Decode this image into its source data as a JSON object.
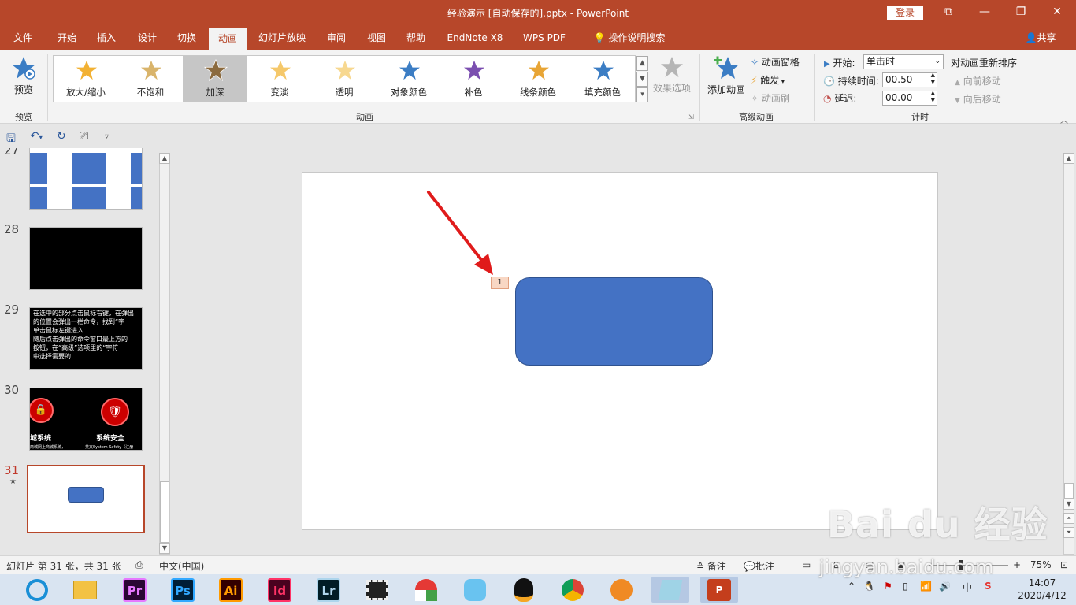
{
  "titlebar": {
    "title": "经验演示 [自动保存的].pptx  -  PowerPoint",
    "login": "登录",
    "restore_symbol": "⧉",
    "minimize_symbol": "—",
    "maximize_symbol": "❐",
    "close_symbol": "✕"
  },
  "tabs": [
    "文件",
    "开始",
    "插入",
    "设计",
    "切换",
    "动画",
    "幻灯片放映",
    "审阅",
    "视图",
    "帮助",
    "EndNote X8",
    "WPS PDF",
    "操作说明搜索"
  ],
  "active_tab": "动画",
  "share": "共享",
  "ribbon": {
    "preview": {
      "label": "预览",
      "group": "预览"
    },
    "animations": {
      "group": "动画",
      "items": [
        {
          "label": "放大/缩小",
          "color": "#f2b133"
        },
        {
          "label": "不饱和",
          "color": "#d9b46b"
        },
        {
          "label": "加深",
          "color": "#8b6a3e"
        },
        {
          "label": "变淡",
          "color": "#f5c86a"
        },
        {
          "label": "透明",
          "color": "#f7d890"
        },
        {
          "label": "对象颜色",
          "color": "#3b7dc4"
        },
        {
          "label": "补色",
          "color": "#7b4fb0"
        },
        {
          "label": "线条颜色",
          "color": "#e8a535"
        },
        {
          "label": "填充颜色",
          "color": "#3b7dc4"
        }
      ],
      "selected": "加深",
      "effect_options": "效果选项"
    },
    "advanced": {
      "group": "高级动画",
      "add_animation": "添加动画",
      "animation_pane": "动画窗格",
      "trigger": "触发",
      "painter": "动画刷"
    },
    "timing": {
      "group": "计时",
      "start_label": "开始:",
      "start_value": "单击时",
      "duration_label": "持续时间:",
      "duration_value": "00.50",
      "delay_label": "延迟:",
      "delay_value": "00.00",
      "reorder": "对动画重新排序",
      "move_earlier": "向前移动",
      "move_later": "向后移动"
    }
  },
  "thumbnails": [
    {
      "num": "27",
      "type": "blocks"
    },
    {
      "num": "28",
      "type": "black"
    },
    {
      "num": "29",
      "type": "text",
      "lines": [
        "在选中的部分点击鼠标右键，在弹出",
        "的位置会弹出一栏命令，找到“字",
        "单击鼠标左键进入…",
        "随后点击弹出的命令窗口最上方的",
        "按钮，在“高级”选项里的“字符",
        "中选择需要的…"
      ]
    },
    {
      "num": "30",
      "type": "icons",
      "labels": [
        "城系统",
        "系统安全"
      ],
      "sublabels": [
        "商城网上商城系统，",
        "英文System Safety（注册"
      ]
    },
    {
      "num": "31",
      "type": "current",
      "star": "★"
    }
  ],
  "slide": {
    "anim_tag": "1",
    "shape_color": "#4472c4"
  },
  "status": {
    "slide_info": "幻灯片 第 31 张，共 31 张",
    "language": "中文(中国)",
    "notes": "备注",
    "comments": "批注",
    "zoom": "75%"
  },
  "taskbar": {
    "apps": [
      {
        "name": "ie",
        "label": ""
      },
      {
        "name": "explorer",
        "label": ""
      },
      {
        "name": "premiere",
        "label": "Pr",
        "color": "#e679ff",
        "bg": "#2a0734"
      },
      {
        "name": "photoshop",
        "label": "Ps",
        "color": "#31a8ff",
        "bg": "#001e36"
      },
      {
        "name": "illustrator",
        "label": "Ai",
        "color": "#ff9a00",
        "bg": "#330000"
      },
      {
        "name": "indesign",
        "label": "Id",
        "color": "#ff3366",
        "bg": "#49021f"
      },
      {
        "name": "lightroom",
        "label": "Lr",
        "color": "#add5ec",
        "bg": "#001d26"
      },
      {
        "name": "video",
        "label": ""
      },
      {
        "name": "app9",
        "label": ""
      },
      {
        "name": "app10",
        "label": ""
      },
      {
        "name": "qq",
        "label": ""
      },
      {
        "name": "chrome",
        "label": ""
      },
      {
        "name": "app13",
        "label": ""
      },
      {
        "name": "app14",
        "label": ""
      },
      {
        "name": "powerpoint",
        "label": "P"
      }
    ],
    "ime": "中",
    "time": "14:07",
    "date": "2020/4/12"
  },
  "watermark": {
    "brand": "Bai du 经验",
    "url": "jingyan.baidu.com"
  }
}
